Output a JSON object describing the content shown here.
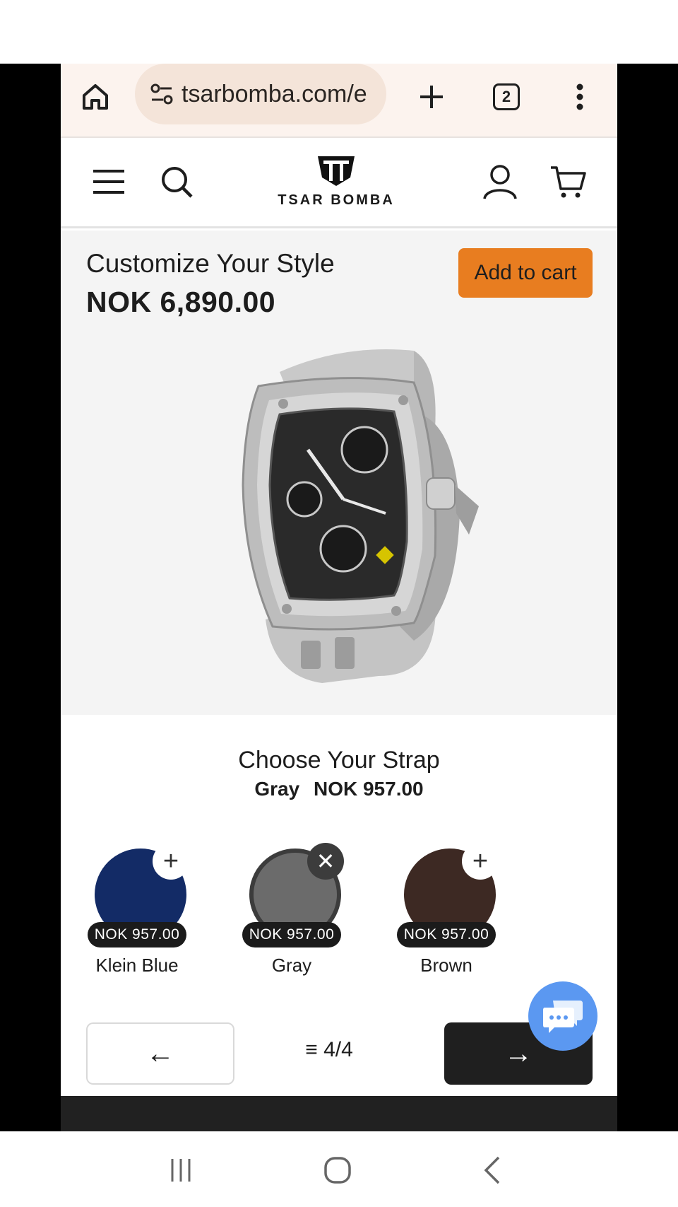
{
  "browser": {
    "url": "tsarbomba.com/e",
    "tab_count": "2",
    "icons": {
      "home": "home-icon",
      "site_info": "tune-icon",
      "new_tab": "plus-icon",
      "menu": "more-vert-icon"
    }
  },
  "site": {
    "brand": "TSAR BOMBA",
    "icons": {
      "menu": "hamburger-icon",
      "search": "search-icon",
      "account": "user-icon",
      "cart": "cart-icon"
    }
  },
  "product": {
    "title": "Customize Your Style",
    "price": "NOK 6,890.00",
    "add_to_cart_label": "Add to cart",
    "accent_color": "#e87d20"
  },
  "strap": {
    "title": "Choose Your Strap",
    "selected_name": "Gray",
    "selected_price": "NOK 957.00",
    "options": [
      {
        "name": "Klein Blue",
        "price": "NOK 957.00",
        "color": "#132b66",
        "state": "add"
      },
      {
        "name": "Gray",
        "price": "NOK 957.00",
        "color": "#6b6b6b",
        "state": "selected"
      },
      {
        "name": "Brown",
        "price": "NOK 957.00",
        "color": "#3d2923",
        "state": "add"
      }
    ]
  },
  "pagination": {
    "prev_arrow": "←",
    "indicator": "4/4",
    "next_arrow": "→"
  },
  "chat": {
    "icon": "chat-bubbles-icon",
    "color": "#5b98f1"
  },
  "android_nav": {
    "recents": "recents-icon",
    "home": "home-circle-icon",
    "back": "back-icon"
  }
}
